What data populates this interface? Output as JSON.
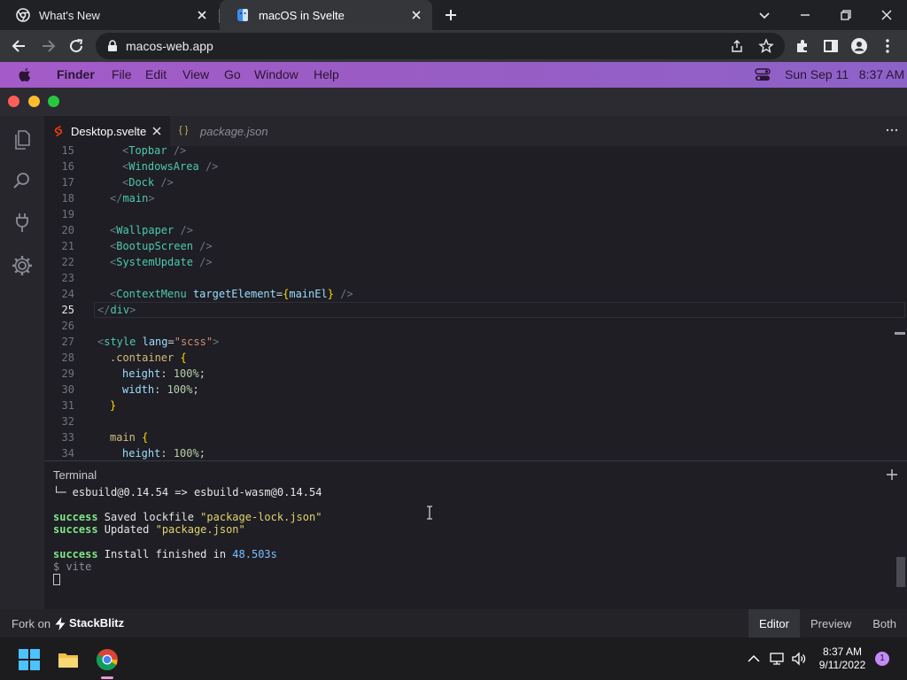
{
  "browser": {
    "tabs": [
      {
        "title": "What's New",
        "active": false
      },
      {
        "title": "macOS in Svelte",
        "active": true
      }
    ],
    "url": "macos-web.app"
  },
  "mac_topbar": {
    "menus": [
      "Finder",
      "File",
      "Edit",
      "View",
      "Go",
      "Window",
      "Help"
    ],
    "datetime": "Sun Sep 11   8:37 AM"
  },
  "editor": {
    "tabs": [
      {
        "title": "Desktop.svelte",
        "active": true
      },
      {
        "title": "package.json",
        "active": false
      }
    ],
    "current_line": "25",
    "lines": [
      {
        "n": "15",
        "parts": [
          [
            "tag",
            "<"
          ],
          [
            "el",
            "Topbar"
          ],
          [
            "tag",
            " />"
          ]
        ],
        "indent": 2
      },
      {
        "n": "16",
        "parts": [
          [
            "tag",
            "<"
          ],
          [
            "el",
            "WindowsArea"
          ],
          [
            "tag",
            " />"
          ]
        ],
        "indent": 2
      },
      {
        "n": "17",
        "parts": [
          [
            "tag",
            "<"
          ],
          [
            "el",
            "Dock"
          ],
          [
            "tag",
            " />"
          ]
        ],
        "indent": 2
      },
      {
        "n": "18",
        "parts": [
          [
            "tag",
            "</"
          ],
          [
            "el",
            "main"
          ],
          [
            "tag",
            ">"
          ]
        ],
        "indent": 1
      },
      {
        "n": "19",
        "parts": [],
        "indent": 0
      },
      {
        "n": "20",
        "parts": [
          [
            "tag",
            "<"
          ],
          [
            "el",
            "Wallpaper"
          ],
          [
            "tag",
            " />"
          ]
        ],
        "indent": 1
      },
      {
        "n": "21",
        "parts": [
          [
            "tag",
            "<"
          ],
          [
            "el",
            "BootupScreen"
          ],
          [
            "tag",
            " />"
          ]
        ],
        "indent": 1
      },
      {
        "n": "22",
        "parts": [
          [
            "tag",
            "<"
          ],
          [
            "el",
            "SystemUpdate"
          ],
          [
            "tag",
            " />"
          ]
        ],
        "indent": 1
      },
      {
        "n": "23",
        "parts": [],
        "indent": 0
      },
      {
        "n": "24",
        "parts": [
          [
            "tag",
            "<"
          ],
          [
            "el",
            "ContextMenu"
          ],
          [
            "txt",
            " "
          ],
          [
            "attr",
            "targetElement"
          ],
          [
            "txt",
            "="
          ],
          [
            "brace",
            "{"
          ],
          [
            "attr",
            "mainEl"
          ],
          [
            "brace",
            "}"
          ],
          [
            "tag",
            " />"
          ]
        ],
        "indent": 1
      },
      {
        "n": "25",
        "parts": [
          [
            "tag",
            "</"
          ],
          [
            "el",
            "div"
          ],
          [
            "tag",
            ">"
          ]
        ],
        "indent": 0
      },
      {
        "n": "26",
        "parts": [],
        "indent": 0
      },
      {
        "n": "27",
        "parts": [
          [
            "tag",
            "<"
          ],
          [
            "el",
            "style"
          ],
          [
            "txt",
            " "
          ],
          [
            "attr",
            "lang"
          ],
          [
            "txt",
            "="
          ],
          [
            "str",
            "\"scss\""
          ],
          [
            "tag",
            ">"
          ]
        ],
        "indent": 0
      },
      {
        "n": "28",
        "parts": [
          [
            "sel",
            ".container"
          ],
          [
            "txt",
            " "
          ],
          [
            "brace",
            "{"
          ]
        ],
        "indent": 1
      },
      {
        "n": "29",
        "parts": [
          [
            "prop",
            "height"
          ],
          [
            "txt",
            ": "
          ],
          [
            "val",
            "100%"
          ],
          [
            "txt",
            ";"
          ]
        ],
        "indent": 2
      },
      {
        "n": "30",
        "parts": [
          [
            "prop",
            "width"
          ],
          [
            "txt",
            ": "
          ],
          [
            "val",
            "100%"
          ],
          [
            "txt",
            ";"
          ]
        ],
        "indent": 2
      },
      {
        "n": "31",
        "parts": [
          [
            "brace",
            "}"
          ]
        ],
        "indent": 1
      },
      {
        "n": "32",
        "parts": [],
        "indent": 0
      },
      {
        "n": "33",
        "parts": [
          [
            "sel",
            "main"
          ],
          [
            "txt",
            " "
          ],
          [
            "brace",
            "{"
          ]
        ],
        "indent": 1
      },
      {
        "n": "34",
        "parts": [
          [
            "prop",
            "height"
          ],
          [
            "txt",
            ": "
          ],
          [
            "val",
            "100%"
          ],
          [
            "txt",
            ";"
          ]
        ],
        "indent": 2
      }
    ]
  },
  "terminal": {
    "title": "Terminal",
    "lines": [
      [
        [
          "txt",
          "└─ esbuild@0.14.54 => esbuild-wasm@0.14.54"
        ]
      ],
      [],
      [
        [
          "g",
          "success"
        ],
        [
          "txt",
          " Saved lockfile "
        ],
        [
          "y",
          "\"package-lock.json\""
        ]
      ],
      [
        [
          "g",
          "success"
        ],
        [
          "txt",
          " Updated "
        ],
        [
          "y",
          "\"package.json\""
        ]
      ],
      [],
      [
        [
          "g",
          "success"
        ],
        [
          "txt",
          " Install finished in "
        ],
        [
          "c",
          "48.503s"
        ]
      ],
      [
        [
          "dim",
          "$ vite"
        ]
      ]
    ]
  },
  "stackblitz": {
    "fork_label": "Fork on",
    "brand": "StackBlitz",
    "views": [
      {
        "label": "Editor",
        "active": true
      },
      {
        "label": "Preview",
        "active": false
      },
      {
        "label": "Both",
        "active": false
      }
    ]
  },
  "taskbar": {
    "time": "8:37 AM",
    "date": "9/11/2022",
    "notifications": "1"
  }
}
